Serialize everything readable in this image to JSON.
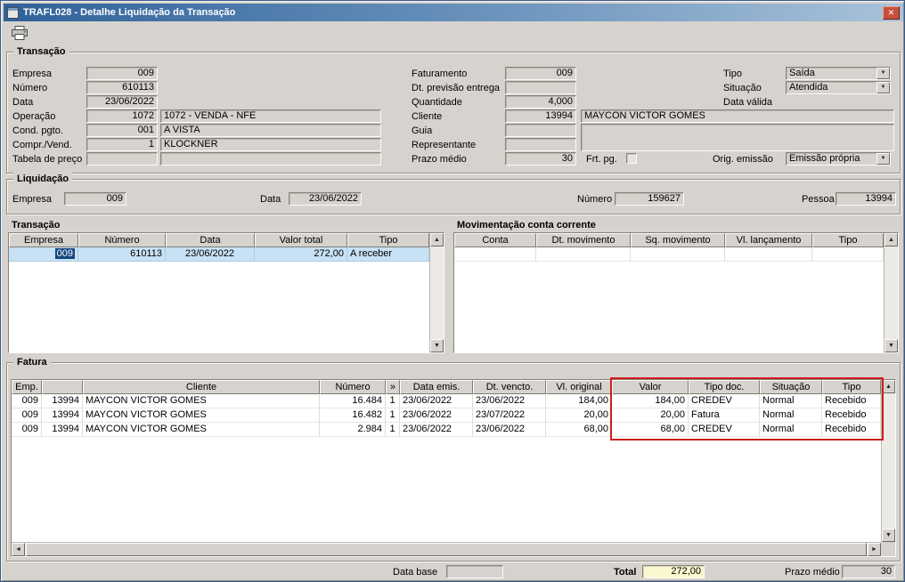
{
  "window": {
    "title": "TRAFL028 - Detalhe Liquidação da Transação"
  },
  "icons": {
    "close": "✕",
    "combo_arrow": "▼",
    "scroll_up": "▲",
    "scroll_down": "▼",
    "scroll_left": "◄",
    "scroll_right": "►"
  },
  "colors": {
    "titlebar_start": "#2f6299",
    "titlebar_end": "#a9c2da",
    "selection_row": "#c7e1f5",
    "selection_cell": "#17477e",
    "highlight_box": "#cf1d1d",
    "window_bg": "#d6d3ce"
  },
  "groups": {
    "transacao": "Transação",
    "liquidacao": "Liquidação",
    "fatura": "Fatura"
  },
  "transacao": {
    "labels": {
      "empresa": "Empresa",
      "numero": "Número",
      "data": "Data",
      "operacao": "Operação",
      "cond_pgto": "Cond. pgto.",
      "compr_vend": "Compr./Vend.",
      "tabela_preco": "Tabela de preço",
      "faturamento": "Faturamento",
      "dt_previsao": "Dt. previsão entrega",
      "quantidade": "Quantidade",
      "cliente": "Cliente",
      "guia": "Guia",
      "representante": "Representante",
      "prazo_medio": "Prazo médio",
      "frt_pg": "Frt. pg.",
      "tipo": "Tipo",
      "situacao": "Situação",
      "data_valida": "Data válida",
      "orig_emissao": "Orig. emissão"
    },
    "values": {
      "empresa": "009",
      "numero": "610113",
      "data": "23/06/2022",
      "operacao_cod": "1072",
      "operacao_desc": "1072 - VENDA - NFE",
      "cond_pgto_cod": "001",
      "cond_pgto_desc": "A VISTA",
      "compr_vend_cod": "1",
      "compr_vend_desc": "KLOCKNER",
      "tabela_preco_cod": "",
      "tabela_preco_desc": "",
      "faturamento": "009",
      "dt_previsao": "",
      "quantidade": "4,000",
      "cliente_cod": "13994",
      "cliente_desc": "MAYCON VICTOR GOMES",
      "guia": "",
      "representante": "",
      "prazo_medio": "30",
      "tipo": "Saída",
      "situacao": "Atendida",
      "data_valida": "",
      "orig_emissao": "Emissão própria"
    }
  },
  "liquidacao": {
    "labels": {
      "empresa": "Empresa",
      "data": "Data",
      "numero": "Número",
      "pessoa": "Pessoa"
    },
    "values": {
      "empresa": "009",
      "data": "23/06/2022",
      "numero": "159627",
      "pessoa": "13994"
    }
  },
  "transacao_grid": {
    "title": "Transação",
    "columns": [
      "Empresa",
      "Número",
      "Data",
      "Valor total",
      "Tipo"
    ],
    "rows": [
      {
        "empresa": "009",
        "numero": "610113",
        "data": "23/06/2022",
        "valor_total": "272,00",
        "tipo": "A receber"
      }
    ]
  },
  "movimentacao_grid": {
    "title": "Movimentação conta corrente",
    "columns": [
      "Conta",
      "Dt. movimento",
      "Sq. movimento",
      "Vl. lançamento",
      "Tipo"
    ],
    "rows": []
  },
  "fatura_grid": {
    "columns": [
      "Emp.",
      "",
      "Cliente",
      "Número",
      "»",
      "Data emis.",
      "Dt. vencto.",
      "Vl. original",
      "Valor",
      "Tipo doc.",
      "Situação",
      "Tipo"
    ],
    "rows": [
      {
        "emp": "009",
        "pessoa": "13994",
        "cliente": "MAYCON VICTOR GOMES",
        "numero": "16.484",
        "seq": "1",
        "data_emis": "23/06/2022",
        "dt_vencto": "23/06/2022",
        "vl_original": "184,00",
        "valor": "184,00",
        "tipo_doc": "CREDEV",
        "situacao": "Normal",
        "tipo": "Recebido"
      },
      {
        "emp": "009",
        "pessoa": "13994",
        "cliente": "MAYCON VICTOR GOMES",
        "numero": "16.482",
        "seq": "1",
        "data_emis": "23/06/2022",
        "dt_vencto": "23/07/2022",
        "vl_original": "20,00",
        "valor": "20,00",
        "tipo_doc": "Fatura",
        "situacao": "Normal",
        "tipo": "Recebido"
      },
      {
        "emp": "009",
        "pessoa": "13994",
        "cliente": "MAYCON VICTOR GOMES",
        "numero": "2.984",
        "seq": "1",
        "data_emis": "23/06/2022",
        "dt_vencto": "23/06/2022",
        "vl_original": "68,00",
        "valor": "68,00",
        "tipo_doc": "CREDEV",
        "situacao": "Normal",
        "tipo": "Recebido"
      }
    ]
  },
  "footer": {
    "data_base_label": "Data base",
    "data_base_value": "",
    "total_label": "Total",
    "total_value": "272,00",
    "prazo_medio_label": "Prazo médio",
    "prazo_medio_value": "30"
  }
}
